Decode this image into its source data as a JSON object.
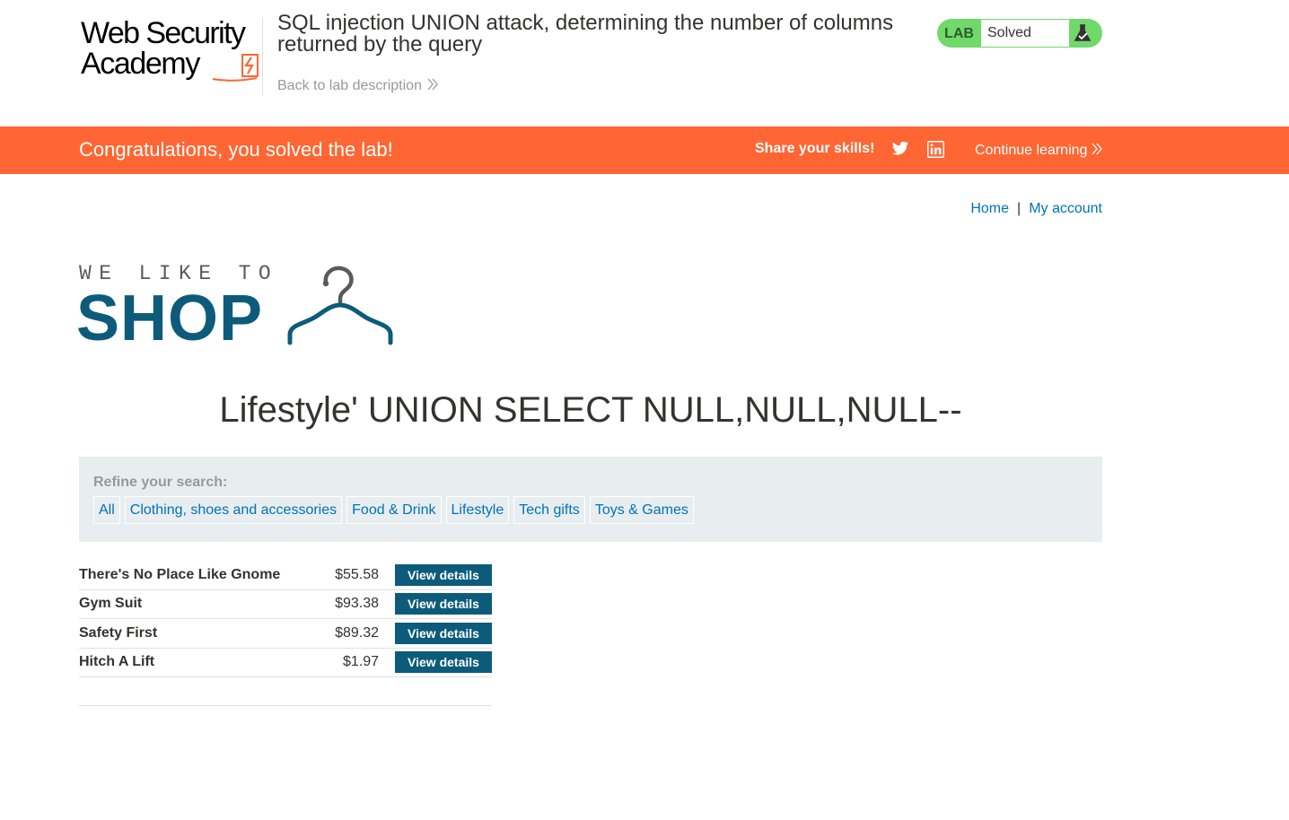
{
  "academy": {
    "logo_line1": "Web Security",
    "logo_line2": "Academy",
    "lab_title": "SQL injection UNION attack, determining the number of columns returned by the query",
    "back_link": "Back to lab description",
    "lab_status_label": "LAB",
    "lab_status_value": "Solved",
    "accent_color": "#ff6633",
    "status_color": "#70d96a"
  },
  "notification": {
    "message": "Congratulations, you solved the lab!",
    "share_label": "Share your skills!",
    "twitter_icon": "twitter-icon",
    "linkedin_icon": "linkedin-icon",
    "continue_link": "Continue learning"
  },
  "shop": {
    "nav": {
      "home": "Home",
      "separator": "|",
      "my_account": "My account"
    },
    "logo_small": "WE LIKE TO",
    "logo_big": "SHOP",
    "brand_color": "#0d5b7a",
    "search_title": "Lifestyle' UNION SELECT NULL,NULL,NULL--",
    "filter": {
      "label": "Refine your search:",
      "categories": [
        "All",
        "Clothing, shoes and accessories",
        "Food & Drink",
        "Lifestyle",
        "Tech gifts",
        "Toys & Games"
      ]
    },
    "products": [
      {
        "name": "There's No Place Like Gnome",
        "price": "$55.58",
        "action": "View details"
      },
      {
        "name": "Gym Suit",
        "price": "$93.38",
        "action": "View details"
      },
      {
        "name": "Safety First",
        "price": "$89.32",
        "action": "View details"
      },
      {
        "name": "Hitch A Lift",
        "price": "$1.97",
        "action": "View details"
      }
    ]
  }
}
